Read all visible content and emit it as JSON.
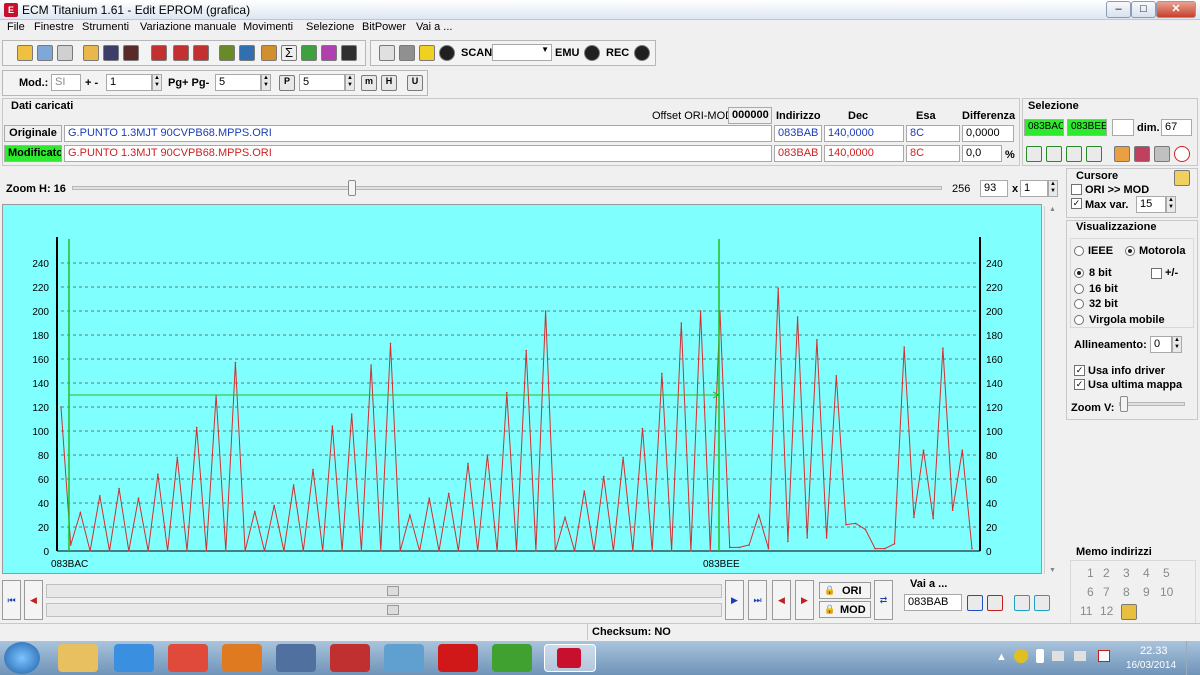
{
  "window": {
    "title": "ECM Titanium 1.61 - Edit EPROM (grafica)"
  },
  "menu": [
    "File",
    "Finestre",
    "Strumenti",
    "Variazione manuale",
    "Movimenti",
    "Selezione",
    "BitPower",
    "Vai a ..."
  ],
  "toolbar": {
    "scan": "SCAN",
    "emu": "EMU",
    "rec": "REC"
  },
  "toolbar2": {
    "mod_label": "Mod.:",
    "mod_value": "SI",
    "plusminus": "+ -",
    "plusminus_value": "1",
    "pg_label": "Pg+ Pg-",
    "pg_value": "5",
    "p_value": "5"
  },
  "dati": {
    "title": "Dati caricati",
    "offset_label": "Offset ORI-MOD",
    "offset_value": "000000",
    "headers": {
      "indirizzo": "Indirizzo",
      "dec": "Dec",
      "esa": "Esa",
      "diff": "Differenza"
    },
    "originale": {
      "label": "Originale",
      "file": "G.PUNTO 1.3MJT 90CVPB68.MPPS.ORI",
      "addr": "083BAB",
      "dec": "140,0000",
      "esa": "8C",
      "diff": "0,0000"
    },
    "modificato": {
      "label": "Modificato",
      "file": "G.PUNTO 1.3MJT 90CVPB68.MPPS.ORI",
      "addr": "083BAB",
      "dec": "140,0000",
      "esa": "8C",
      "diff": "0,0",
      "pct": "%"
    }
  },
  "selezione": {
    "title": "Selezione",
    "start": "083BAC",
    "end": "083BEE",
    "dim_label": "dim.",
    "dim_value": "67"
  },
  "zoom": {
    "label": "Zoom H: 16",
    "max": "256",
    "value": "93",
    "x_label": "x",
    "x_value": "1"
  },
  "cursore": {
    "title": "Cursore",
    "ori_mod": "ORI >> MOD",
    "max_var_label": "Max var.",
    "max_var_value": "15",
    "ori_mod_checked": false,
    "max_var_checked": true
  },
  "visual": {
    "title": "Visualizzazione",
    "ieee": "IEEE",
    "motorola": "Motorola",
    "bit8": "8 bit",
    "bit16": "16 bit",
    "bit32": "32 bit",
    "virgola": "Virgola mobile",
    "sign": "+/-",
    "allineamento_label": "Allineamento:",
    "allineamento_value": "0",
    "usa_info": "Usa info driver",
    "usa_ultima": "Usa ultima mappa",
    "zoomv": "Zoom V:"
  },
  "memo": {
    "title": "Memo indirizzi",
    "numbers": [
      "1",
      "2",
      "3",
      "4",
      "5",
      "6",
      "7",
      "8",
      "9",
      "10",
      "11",
      "12"
    ]
  },
  "bottom": {
    "ori": "ORI",
    "mod": "MOD",
    "vai_label": "Vai a ...",
    "vai_value": "083BAB",
    "checksum": "Checksum: NO"
  },
  "chart_data": {
    "type": "line",
    "x_start_label": "083BAC",
    "x_end_label": "083BEE",
    "ylim": [
      0,
      255
    ],
    "yticks": [
      0,
      20,
      40,
      60,
      80,
      100,
      120,
      140,
      160,
      180,
      200,
      220,
      240
    ],
    "grid": true,
    "cursor_level": 130,
    "series": [
      {
        "color": "#d03030",
        "values": [
          120,
          5,
          32,
          0,
          46,
          0,
          52,
          0,
          44,
          0,
          64,
          0,
          78,
          0,
          103,
          0,
          130,
          0,
          157,
          0,
          33,
          0,
          38,
          0,
          55,
          0,
          68,
          0,
          104,
          0,
          114,
          0,
          155,
          0,
          173,
          0,
          30,
          0,
          44,
          0,
          48,
          0,
          73,
          0,
          80,
          0,
          132,
          0,
          167,
          0,
          200,
          0,
          28,
          0,
          50,
          0,
          62,
          0,
          78,
          0,
          102,
          0,
          148,
          0,
          190,
          0,
          200,
          0,
          200,
          3,
          3,
          5,
          30,
          2,
          219,
          8,
          195,
          11,
          176,
          11,
          146,
          22,
          23,
          18,
          2,
          2,
          6,
          170,
          28,
          84,
          27,
          169,
          34,
          84,
          2
        ]
      }
    ]
  },
  "taskbar": {
    "time": "22.33",
    "date": "16/03/2014"
  }
}
